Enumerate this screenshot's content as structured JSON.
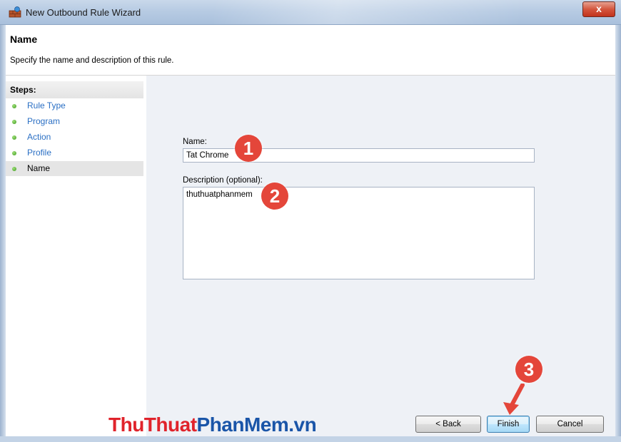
{
  "window": {
    "title": "New Outbound Rule Wizard",
    "close_symbol": "x",
    "icon": "firewall-icon"
  },
  "header": {
    "title": "Name",
    "subtitle": "Specify the name and description of this rule."
  },
  "steps": {
    "heading": "Steps:",
    "items": [
      {
        "label": "Rule Type",
        "state": "completed"
      },
      {
        "label": "Program",
        "state": "completed"
      },
      {
        "label": "Action",
        "state": "completed"
      },
      {
        "label": "Profile",
        "state": "completed"
      },
      {
        "label": "Name",
        "state": "current"
      }
    ]
  },
  "form": {
    "name_label": "Name:",
    "name_value": "Tat Chrome",
    "description_label": "Description (optional):",
    "description_value": "thuthuatphanmem"
  },
  "buttons": {
    "back": "< Back",
    "finish": "Finish",
    "cancel": "Cancel"
  },
  "annotations": {
    "marker1": "1",
    "marker2": "2",
    "marker3": "3",
    "marker_color": "#e4463a"
  },
  "watermark": {
    "part1": "ThuThuat",
    "part2": "PhanMem",
    "part3": ".vn"
  }
}
